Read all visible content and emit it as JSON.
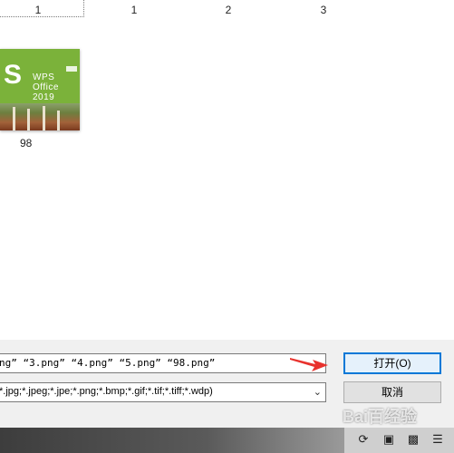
{
  "column_numbers": [
    "1",
    "1",
    "2",
    "3"
  ],
  "thumbnail": {
    "name": "98",
    "logo_letter": "S",
    "logo_text": "WPS Office 2019"
  },
  "file_name": {
    "value": "ng” “3.png” “4.png” “5.png” “98.png”"
  },
  "file_type": {
    "value": "*.jpg;*.jpeg;*.jpe;*.png;*.bmp;*.gif;*.tif;*.tiff;*.wdp)"
  },
  "buttons": {
    "open": "打开(O)",
    "cancel": "取消"
  },
  "watermark": "Bai百经验",
  "colors": {
    "open_border": "#0078d7",
    "arrow": "#e8322d",
    "thumb_green": "#7bb23a"
  },
  "icons": [
    "rotate-icon",
    "fit-screen-icon",
    "thumbnail-view-icon",
    "list-view-icon"
  ]
}
